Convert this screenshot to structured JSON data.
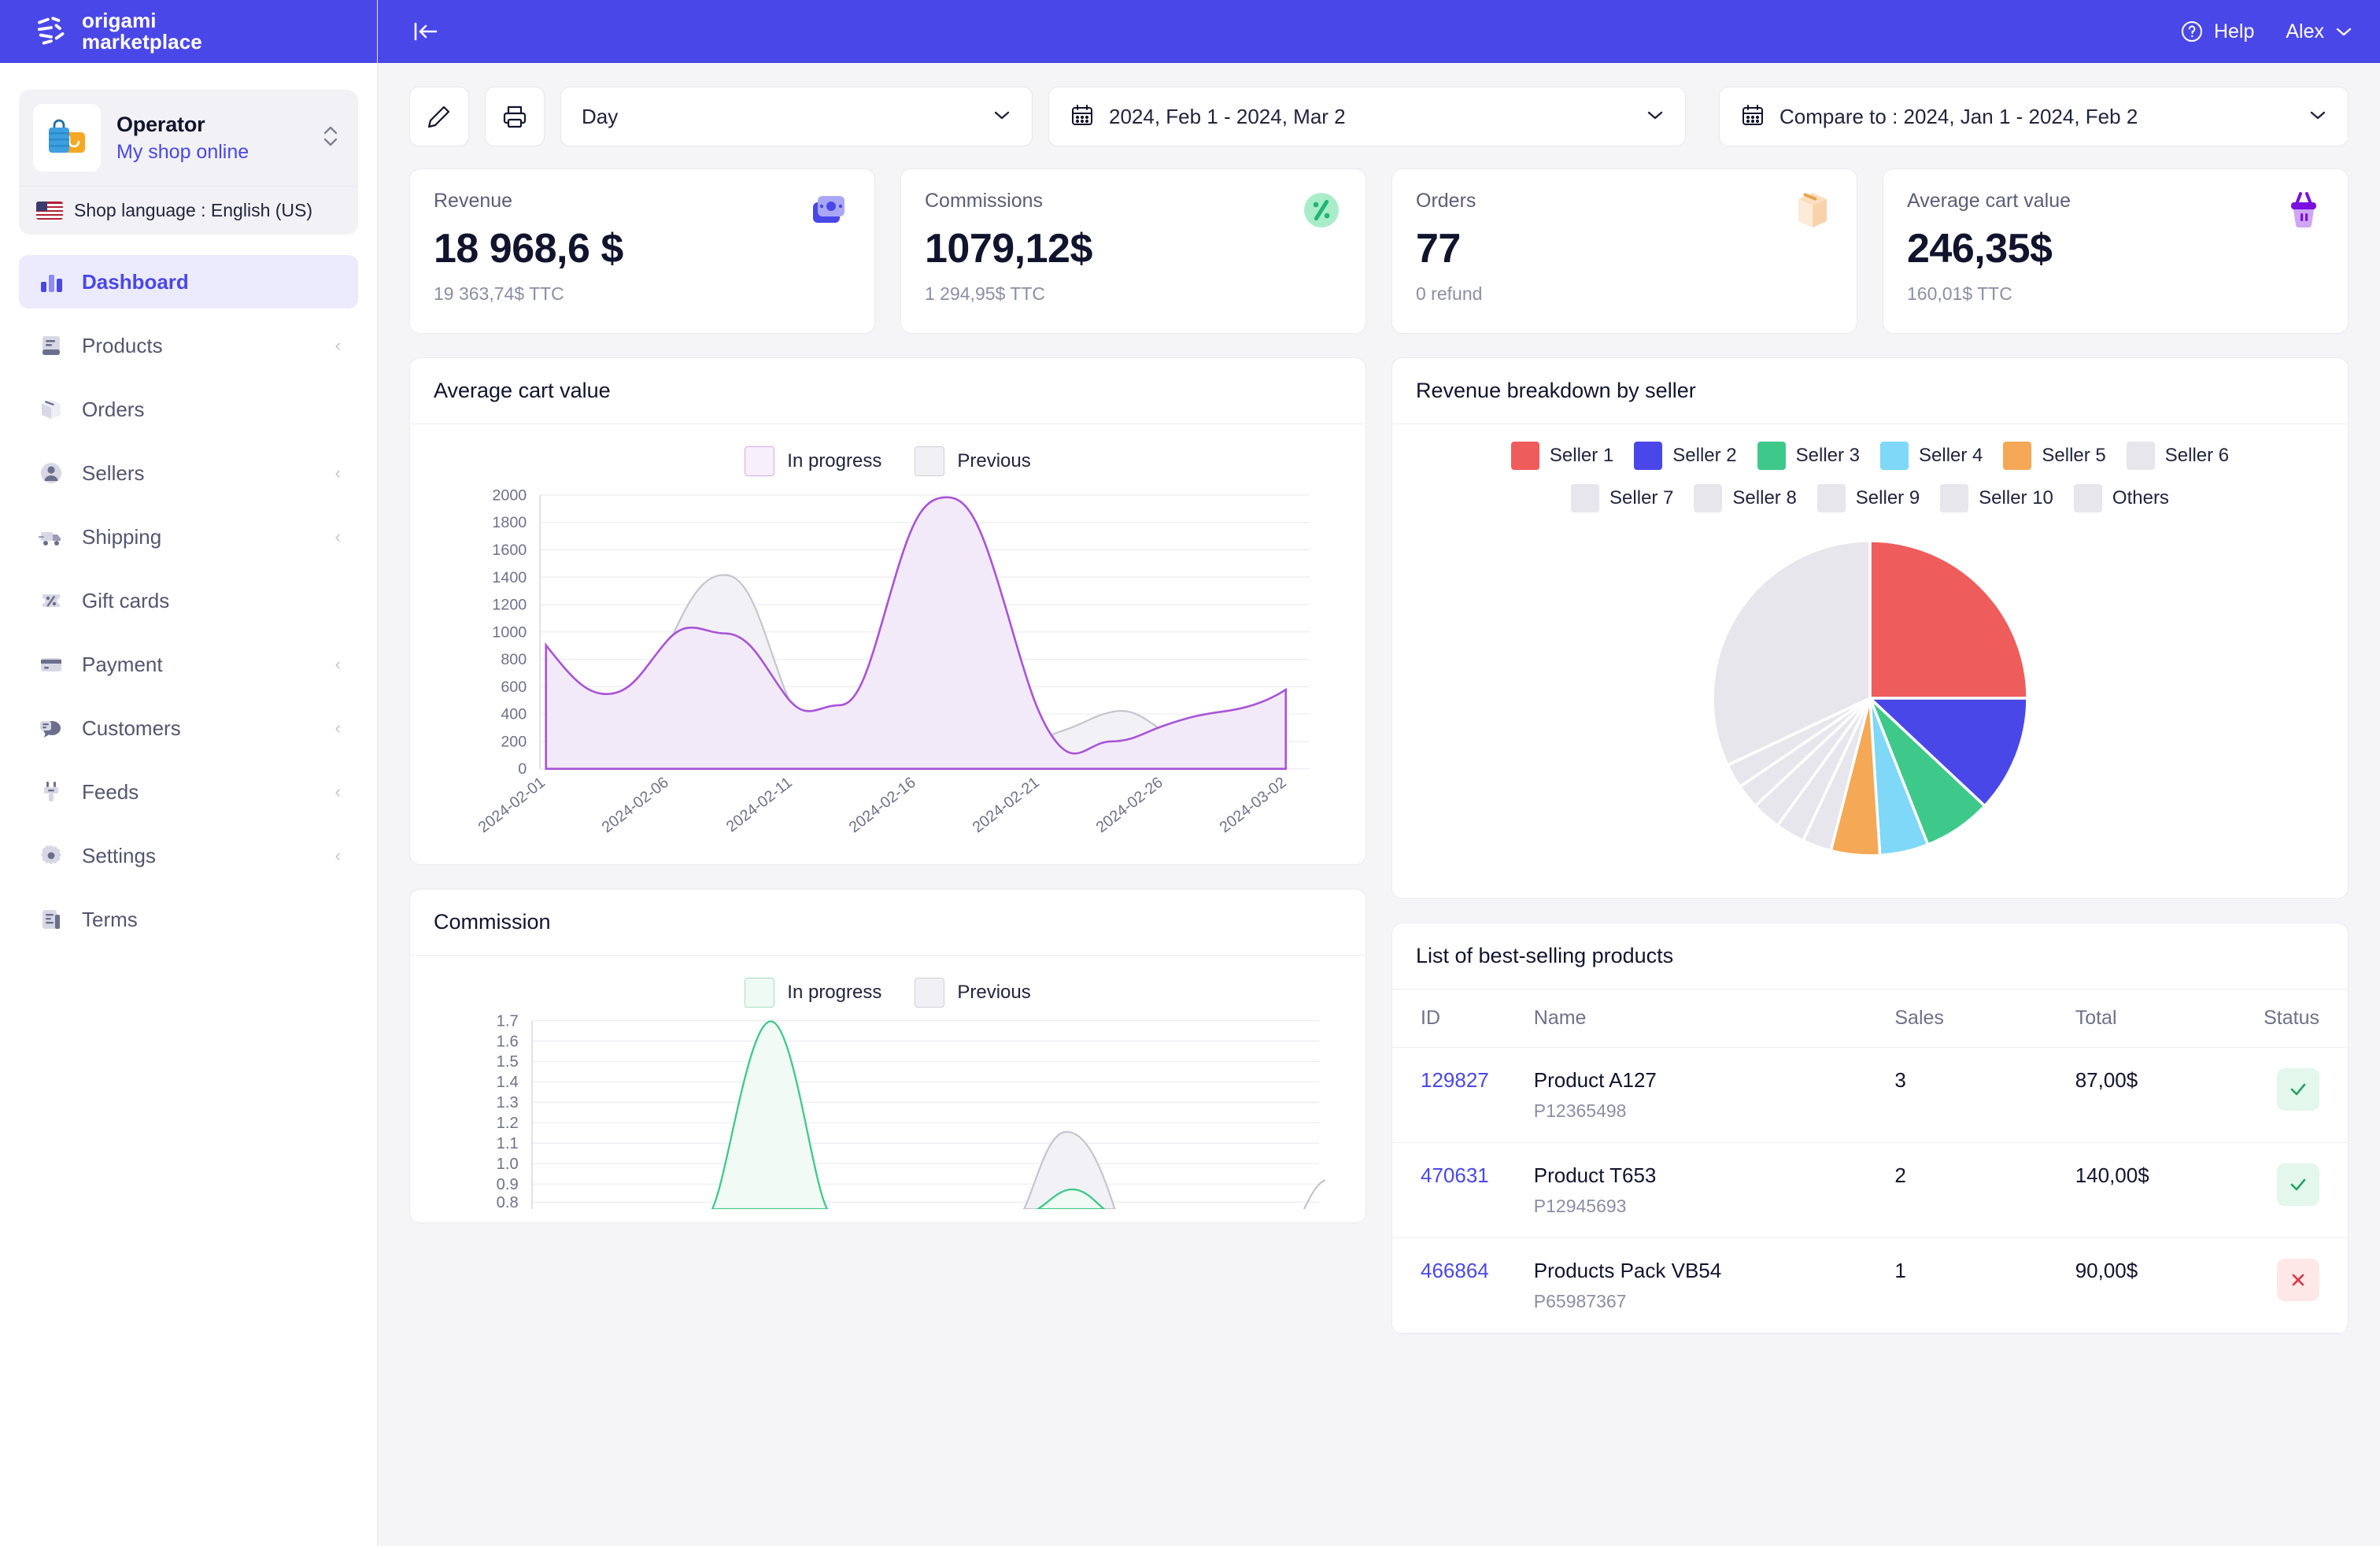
{
  "brand": {
    "line1": "origami",
    "line2": "marketplace",
    "color": "#4a47e8"
  },
  "topbar": {
    "help_label": "Help",
    "user_label": "Alex",
    "collapse_icon": "collapse-sidebar-icon"
  },
  "sidebar": {
    "shop": {
      "name": "Operator",
      "subtitle": "My shop online"
    },
    "language": {
      "label": "Shop language : English (US)"
    },
    "items": [
      {
        "label": "Dashboard",
        "icon": "bar-chart-icon",
        "active": true,
        "expandable": false
      },
      {
        "label": "Products",
        "icon": "book-icon",
        "active": false,
        "expandable": true
      },
      {
        "label": "Orders",
        "icon": "box-icon",
        "active": false,
        "expandable": false
      },
      {
        "label": "Sellers",
        "icon": "user-icon",
        "active": false,
        "expandable": true
      },
      {
        "label": "Shipping",
        "icon": "truck-icon",
        "active": false,
        "expandable": true
      },
      {
        "label": "Gift cards",
        "icon": "percent-tag-icon",
        "active": false,
        "expandable": false
      },
      {
        "label": "Payment",
        "icon": "credit-card-icon",
        "active": false,
        "expandable": true
      },
      {
        "label": "Customers",
        "icon": "chat-icon",
        "active": false,
        "expandable": true
      },
      {
        "label": "Feeds",
        "icon": "plug-icon",
        "active": false,
        "expandable": true
      },
      {
        "label": "Settings",
        "icon": "gear-icon",
        "active": false,
        "expandable": true
      },
      {
        "label": "Terms",
        "icon": "document-icon",
        "active": false,
        "expandable": false
      }
    ]
  },
  "toolbar": {
    "edit_icon": "pencil-icon",
    "print_icon": "printer-icon",
    "period": {
      "value": "Day"
    },
    "date_range": {
      "value": "2024, Feb 1 - 2024, Mar 2",
      "icon": "calendar-icon"
    },
    "compare": {
      "value": "Compare to : 2024, Jan 1 - 2024, Feb 2",
      "icon": "calendar-icon"
    }
  },
  "kpis": [
    {
      "title": "Revenue",
      "value": "18 968,6 $",
      "sub": "19 363,74$ TTC",
      "icon": "money-icon"
    },
    {
      "title": "Commissions",
      "value": "1079,12$",
      "sub": "1 294,95$ TTC",
      "icon": "percent-icon"
    },
    {
      "title": "Orders",
      "value": "77",
      "sub": "0 refund",
      "icon": "package-icon"
    },
    {
      "title": "Average cart value",
      "value": "246,35$",
      "sub": "160,01$ TTC",
      "icon": "basket-icon"
    }
  ],
  "cards": {
    "avg_cart": {
      "title": "Average cart value"
    },
    "revenue_breakdown": {
      "title": "Revenue breakdown by seller"
    },
    "commission": {
      "title": "Commission"
    },
    "best_sellers": {
      "title": "List of best-selling products"
    }
  },
  "legend": {
    "in_progress": "In progress",
    "previous": "Previous"
  },
  "best_selling": {
    "columns": [
      "ID",
      "Name",
      "Sales",
      "Total",
      "Status"
    ],
    "rows": [
      {
        "id": "129827",
        "name": "Product A127",
        "ref": "P12365498",
        "sales": "3",
        "total": "87,00$",
        "status": "ok"
      },
      {
        "id": "470631",
        "name": "Product T653",
        "ref": "P12945693",
        "sales": "2",
        "total": "140,00$",
        "status": "ok"
      },
      {
        "id": "466864",
        "name": "Products Pack VB54",
        "ref": "P65987367",
        "sales": "1",
        "total": "90,00$",
        "status": "no"
      }
    ]
  },
  "chart_data": [
    {
      "type": "area",
      "title": "Average cart value",
      "xlabel": "",
      "ylabel": "",
      "ylim": [
        0,
        2000
      ],
      "yticks": [
        0,
        200,
        400,
        600,
        800,
        1000,
        1200,
        1400,
        1600,
        1800,
        2000
      ],
      "grid": true,
      "legend_position": "top-center",
      "x": [
        "2024-02-01",
        "2024-02-06",
        "2024-02-11",
        "2024-02-16",
        "2024-02-21",
        "2024-02-26",
        "2024-03-02"
      ],
      "xtick_labels": [
        "2024-02-01",
        "2024-02-06",
        "2024-02-11",
        "2024-02-16",
        "2024-02-21",
        "2024-02-26",
        "2024-03-02"
      ],
      "series": [
        {
          "name": "In progress",
          "color": "#a855d6",
          "values": [
            900,
            550,
            990,
            470,
            2000,
            200,
            580
          ]
        },
        {
          "name": "Previous",
          "color": "#c6c6d0",
          "values": [
            500,
            245,
            1420,
            240,
            665,
            195,
            250
          ]
        }
      ]
    },
    {
      "type": "pie",
      "title": "Revenue breakdown by seller",
      "legend_position": "top",
      "labels": [
        "Seller 1",
        "Seller 2",
        "Seller 3",
        "Seller 4",
        "Seller 5",
        "Seller 6",
        "Seller 7",
        "Seller 8",
        "Seller 9",
        "Seller 10",
        "Others"
      ],
      "colors": [
        "#ef5c5c",
        "#4a47e8",
        "#3ec98a",
        "#7fd8f7",
        "#f5a855",
        "#e6e6ec",
        "#e6e6ec",
        "#e6e6ec",
        "#e6e6ec",
        "#e6e6ec",
        "#e6e6ec"
      ],
      "values": [
        25.0,
        12.0,
        7.0,
        5.0,
        5.0,
        3.0,
        3.0,
        3.0,
        2.5,
        2.5,
        32.0
      ]
    },
    {
      "type": "area",
      "title": "Commission",
      "xlabel": "",
      "ylabel": "",
      "ylim": [
        0.7,
        1.7
      ],
      "yticks": [
        0.8,
        0.9,
        1.0,
        1.1,
        1.2,
        1.3,
        1.4,
        1.5,
        1.6,
        1.7
      ],
      "ytick_labels": [
        "0.8",
        "0.9",
        "1.0",
        "1.1",
        "1.2",
        "1.3",
        "1.4",
        "1.5",
        "1.6",
        "1.7"
      ],
      "grid": true,
      "legend_position": "top-center",
      "series": [
        {
          "name": "In progress",
          "color": "#3ec98a",
          "values": [
            0.72,
            0.73,
            1.7,
            0.74,
            0.85,
            0.73,
            0.74
          ]
        },
        {
          "name": "Previous",
          "color": "#c6c6d0",
          "values": [
            0.71,
            0.72,
            0.73,
            0.74,
            1.18,
            0.73,
            0.76
          ]
        }
      ]
    }
  ]
}
